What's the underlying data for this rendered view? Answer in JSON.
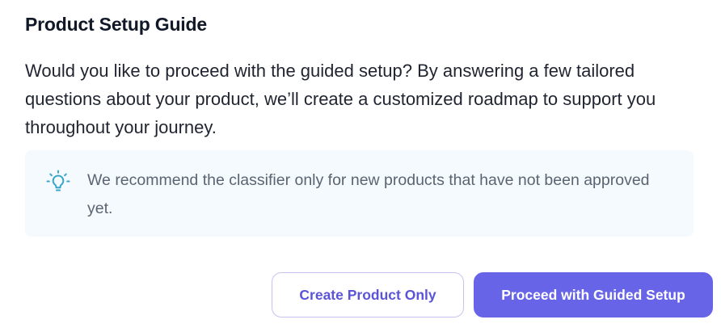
{
  "dialog": {
    "title": "Product Setup Guide",
    "body": "Would you like to proceed with the guided setup? By answering a few tailored questions about your product, we’ll create a customized roadmap to support you throughout your journey.",
    "note": {
      "icon": "lightbulb-icon",
      "text": "We recommend the classifier only for new products that have not been approved yet."
    },
    "actions": {
      "secondary_label": "Create Product Only",
      "primary_label": "Proceed with Guided Setup"
    }
  },
  "colors": {
    "accent": "#6864e8",
    "secondary_text": "#5b55d6",
    "secondary_border": "#c6c3f2",
    "note_background": "#f4fafd",
    "icon_color": "#3aa6c9"
  }
}
